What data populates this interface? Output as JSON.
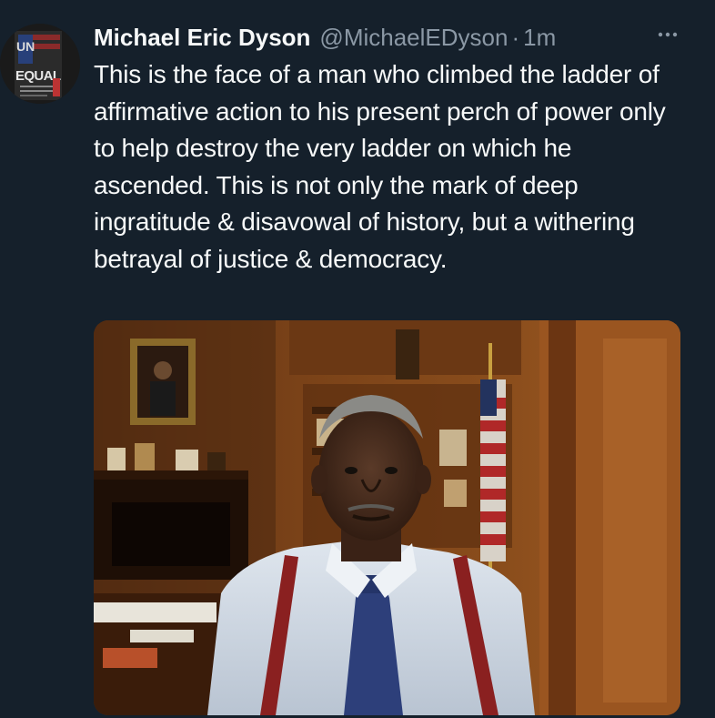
{
  "author": {
    "display_name": "Michael Eric Dyson",
    "handle": "@MichaelEDyson",
    "separator": "·",
    "time": "1m",
    "avatar": {
      "logo_text_top": "UN",
      "logo_text_bottom": "EQUAL"
    }
  },
  "tweet": {
    "text": "This is the face of a man who climbed the ladder of affirmative action to his present perch of power only to help destroy the very ladder on which he ascended. This is not only the mark of deep ingratitude & disavowal of history, but a withering betrayal of justice & democracy."
  },
  "icons": {
    "more": "more-horizontal-icon"
  },
  "colors": {
    "background": "#15202b",
    "primary_text": "#f7f9f9",
    "secondary_text": "#8b98a5"
  }
}
